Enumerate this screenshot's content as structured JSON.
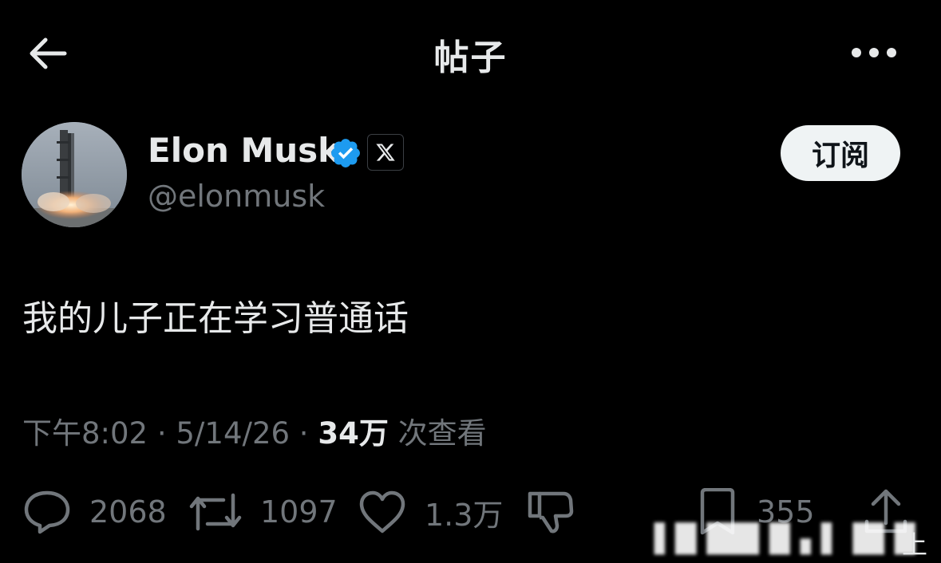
{
  "header": {
    "title": "帖子",
    "back_icon": "arrow-left-icon",
    "more_icon": "more-horizontal-icon"
  },
  "author": {
    "name": "Elon Musk",
    "handle": "@elonmusk",
    "verified_icon": "verified-badge-icon",
    "verified_color": "#1d9bf0",
    "affiliate_icon": "x-logo-icon"
  },
  "subscribe_label": "订阅",
  "tweet": {
    "text": "我的儿子正在学习普通话"
  },
  "meta": {
    "time": "下午8:02",
    "separator": "·",
    "date": "5/14/26",
    "views": "34万",
    "views_label": "次查看"
  },
  "actions": {
    "replies": "2068",
    "reposts": "1097",
    "likes": "1.3万",
    "bookmarks": "355"
  },
  "watermark": {
    "end_char": "上"
  },
  "colors": {
    "background": "#000000",
    "primary_text": "#e7e9ea",
    "secondary_text": "#71767b",
    "accent": "#1d9bf0",
    "button_bg": "#eff3f4"
  }
}
